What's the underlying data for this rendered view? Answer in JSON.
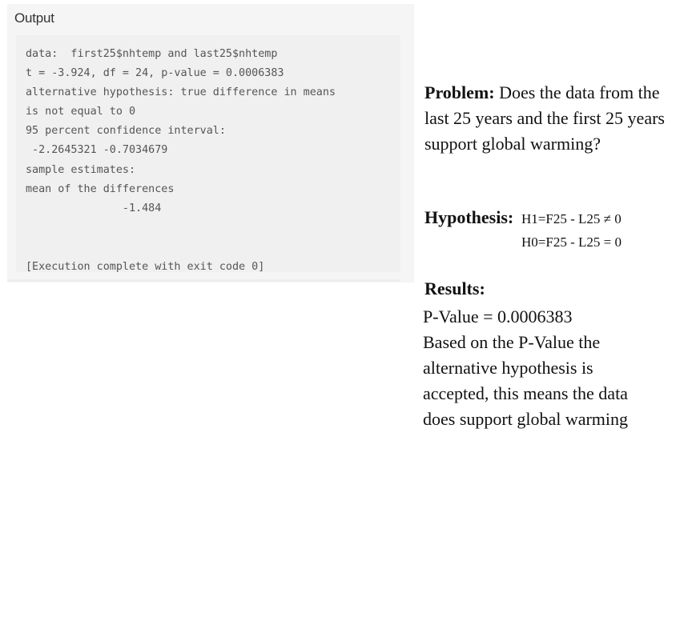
{
  "output_panel": {
    "title": "Output",
    "lines": [
      "data:  first25$nhtemp and last25$nhtemp",
      "t = -3.924, df = 24, p-value = 0.0006383",
      "alternative hypothesis: true difference in means",
      "is not equal to 0",
      "95 percent confidence interval:",
      " -2.2645321 -0.7034679",
      "sample estimates:",
      "mean of the differences",
      "               -1.484",
      "",
      "",
      "[Execution complete with exit code 0]"
    ]
  },
  "problem": {
    "label": "Problem:",
    "text": " Does the data from the last 25 years and the first 25 years support global warming?"
  },
  "hypothesis": {
    "label": "Hypothesis:",
    "h1": "H1=F25 - L25 ≠ 0",
    "h0": "H0=F25 - L25 = 0"
  },
  "results": {
    "label": "Results:",
    "p_value_line": "P-Value = 0.0006383",
    "conclusion": "Based on the P-Value the alternative hypothesis is accepted, this means the data does support global warming"
  }
}
